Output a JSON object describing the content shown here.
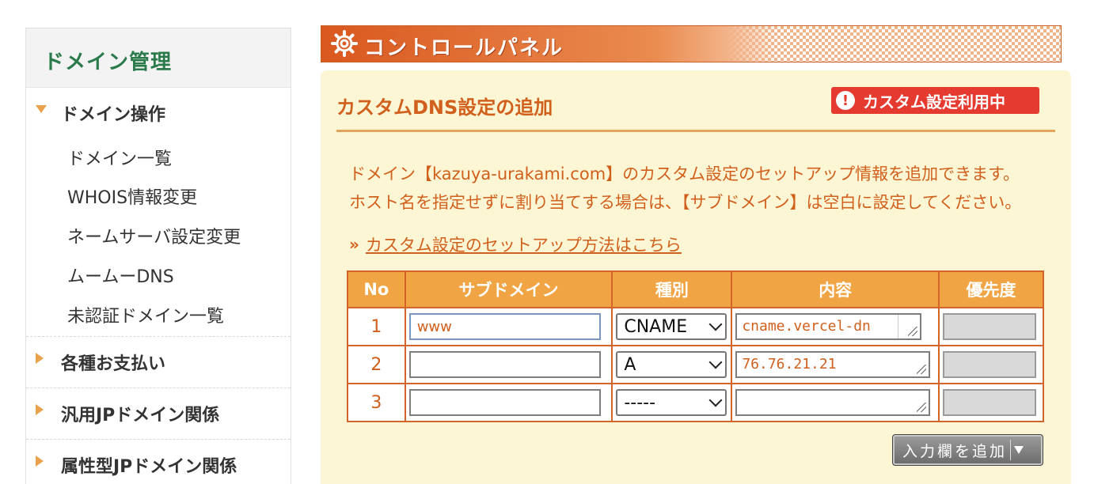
{
  "sidebar": {
    "title": "ドメイン管理",
    "groups": [
      {
        "label": "ドメイン操作",
        "items": [
          "ドメイン一覧",
          "WHOIS情報変更",
          "ネームサーバ設定変更",
          "ムームーDNS",
          "未認証ドメイン一覧"
        ]
      },
      {
        "label": "各種お支払い"
      },
      {
        "label": "汎用JPドメイン関係"
      },
      {
        "label": "属性型JPドメイン関係"
      }
    ]
  },
  "panel": {
    "title": "コントロールパネル"
  },
  "content": {
    "title": "カスタムDNS設定の追加",
    "badge": "カスタム設定利用中",
    "badge_icon": "!",
    "desc_line1": "ドメイン【kazuya-urakami.com】のカスタム設定のセットアップ情報を追加できます。",
    "desc_line2": "ホスト名を指定せずに割り当てする場合は、【サブドメイン】は空白に設定してください。",
    "guide_link": "カスタム設定のセットアップ方法はこちら",
    "guide_icon": "»"
  },
  "table": {
    "headers": [
      "No",
      "サブドメイン",
      "種別",
      "内容",
      "優先度"
    ],
    "rows": [
      {
        "no": "1",
        "subdomain": "www",
        "type": "CNAME",
        "content": "cname.vercel-dn",
        "priority": ""
      },
      {
        "no": "2",
        "subdomain": "",
        "type": "A",
        "content": "76.76.21.21",
        "priority": ""
      },
      {
        "no": "3",
        "subdomain": "",
        "type": "-----",
        "content": "",
        "priority": ""
      }
    ]
  },
  "add_button": {
    "label": "入力欄を追加"
  },
  "colors": {
    "accent": "#d0601c",
    "header_bg": "#f0a443",
    "content_bg": "#fdf6d5",
    "sidebar_title": "#2b7a4b",
    "badge_bg": "#e53a2f"
  }
}
